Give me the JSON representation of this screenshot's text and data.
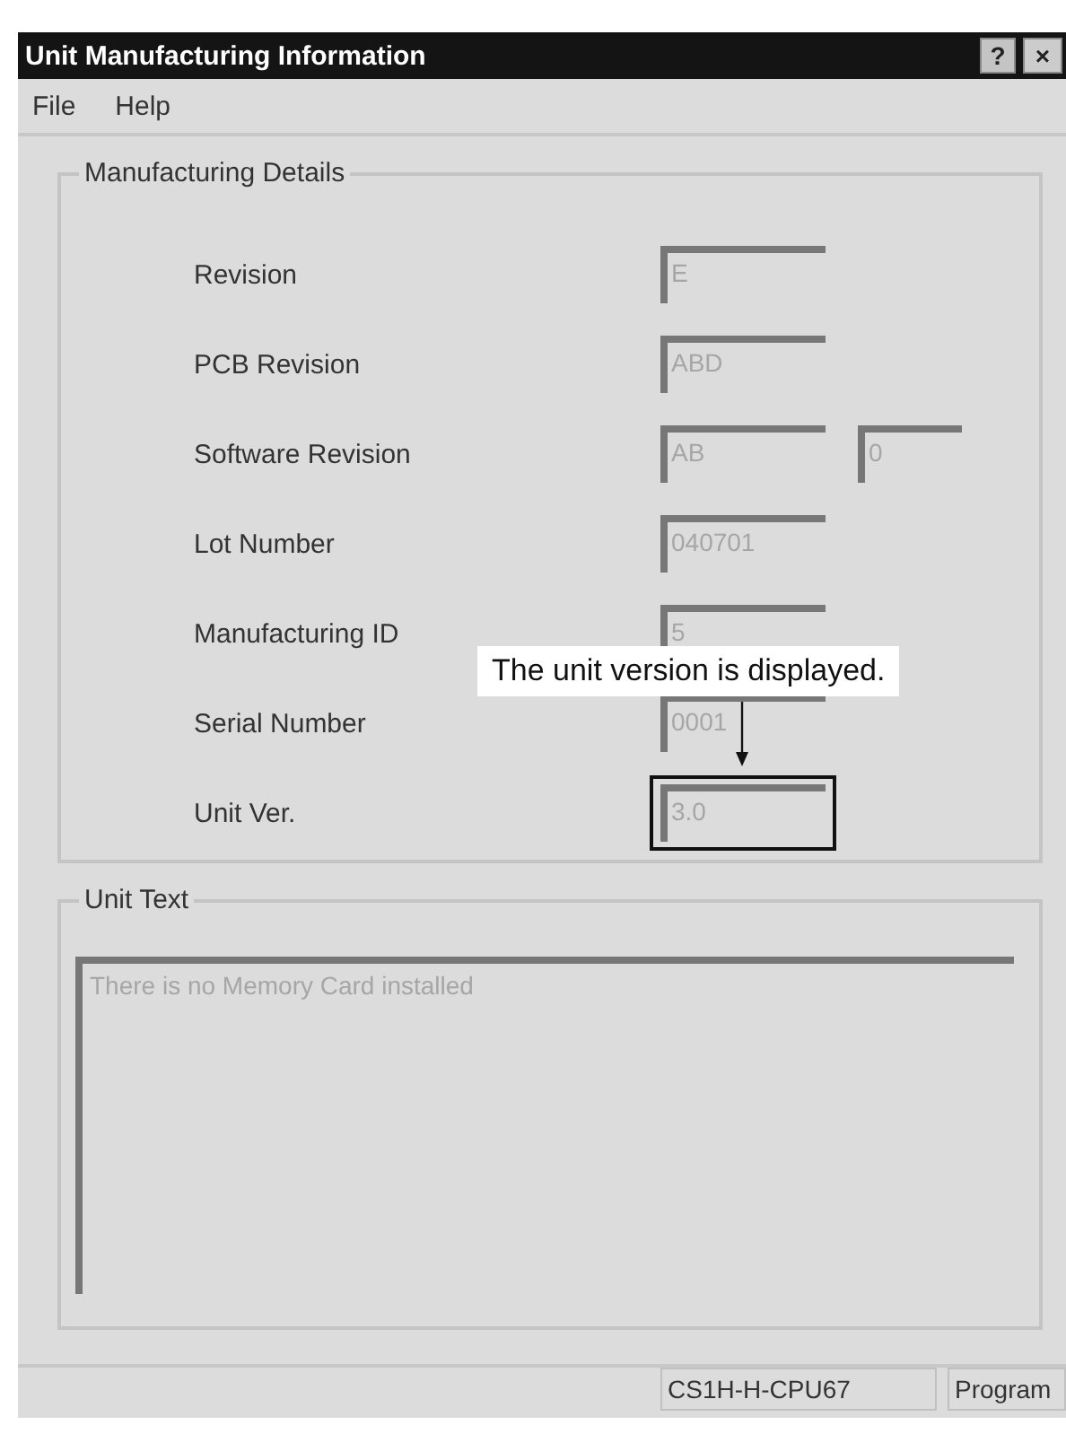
{
  "window": {
    "title": "Unit Manufacturing Information",
    "buttons": [
      {
        "kind": "help",
        "label": "?"
      },
      {
        "kind": "close",
        "label": "×"
      }
    ]
  },
  "menu": [
    {
      "label": "File"
    },
    {
      "label": "Help"
    }
  ],
  "manufacturing_details": {
    "title": "Manufacturing Details",
    "rows": [
      {
        "label": "Revision",
        "fields": [
          {
            "value": "E",
            "disabled": true
          }
        ]
      },
      {
        "label": "PCB Revision",
        "fields": [
          {
            "value": "ABD",
            "disabled": true
          }
        ]
      },
      {
        "label": "Software Revision",
        "fields": [
          {
            "value": "AB",
            "disabled": true
          },
          {
            "value": "0",
            "disabled": true
          }
        ]
      },
      {
        "label": "Lot Number",
        "fields": [
          {
            "value": "040701",
            "disabled": true
          }
        ]
      },
      {
        "label": "Manufacturing ID",
        "fields": [
          {
            "value": "5",
            "disabled": true
          }
        ]
      },
      {
        "label": "Serial Number",
        "fields": [
          {
            "value": "0001",
            "disabled": true
          }
        ]
      },
      {
        "label": "Unit Ver.",
        "fields": [
          {
            "value": "3.0",
            "disabled": true
          }
        ],
        "highlighted": true
      }
    ]
  },
  "unit_text": {
    "title": "Unit Text",
    "value": "There is no Memory Card installed",
    "disabled": true
  },
  "annotation": {
    "text": "The unit version is displayed."
  },
  "status_bar": [
    "CS1H-H-CPU67",
    "Program"
  ]
}
